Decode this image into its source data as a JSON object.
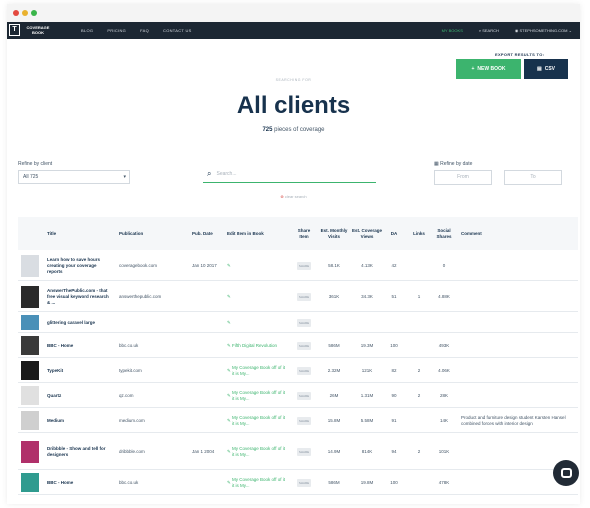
{
  "brand": {
    "logo_text": "COVERAGE BOOK",
    "logo_glyph": "T"
  },
  "nav": {
    "links": [
      "BLOG",
      "PRICING",
      "FAQ",
      "CONTACT US"
    ],
    "my_books": "MY BOOKS",
    "search": "SEARCH",
    "account": "STEPHSOMETHING.COM"
  },
  "export": {
    "label": "EXPORT RESULTS TO:",
    "new_book": "NEW BOOK",
    "csv": "CSV"
  },
  "header": {
    "eyebrow": "SEARCHING FOR",
    "title": "All clients",
    "count": "725",
    "count_suffix": "pieces of coverage"
  },
  "filters": {
    "refine_label": "Refine by client",
    "refine_value": "All 725",
    "search_placeholder": "Search...",
    "clear_search": "clear search",
    "date_label": "Refine by date",
    "date_from": "From",
    "date_to": "To"
  },
  "table": {
    "headers": [
      "Title",
      "Publication",
      "Pub. Date",
      "Edit Item in Book",
      "Share Item",
      "Est. Monthly Visits",
      "Est. Coverage Views",
      "DA",
      "Links",
      "Social Shares",
      "Comment"
    ],
    "share_label": "SHARE",
    "rows": [
      {
        "title": "Learn how to save hours creating your coverage reports",
        "publication": "coveragebook.com",
        "date": "Jan 10 2017",
        "book": "",
        "visits": "58.1K",
        "views": "4.13K",
        "da": "42",
        "links": "",
        "shares": "0",
        "comment": "",
        "thumb": "#d9dde2"
      },
      {
        "title": "AnswerThePublic.com - that free visual keyword research & ...",
        "publication": "answerthepublic.com",
        "date": "",
        "book": "",
        "visits": "361K",
        "views": "34.3K",
        "da": "51",
        "links": "1",
        "shares": "4.88K",
        "comment": "",
        "thumb": "#2b2b2b"
      },
      {
        "title": "glittering caravel large",
        "publication": "",
        "date": "",
        "book": "",
        "visits": "",
        "views": "",
        "da": "",
        "links": "",
        "shares": "",
        "comment": "",
        "thumb": "#4a90b8"
      },
      {
        "title": "BBC - Home",
        "publication": "bbc.co.uk",
        "date": "",
        "book": "Fifth Digital Revolution",
        "visits": "586M",
        "views": "19.3M",
        "da": "100",
        "links": "",
        "shares": "493K",
        "comment": "",
        "thumb": "#3a3a3a"
      },
      {
        "title": "TypeKit",
        "publication": "typekit.com",
        "date": "",
        "book": "My Coverage Book off of it it is My...",
        "visits": "2.32M",
        "views": "121K",
        "da": "82",
        "links": "2",
        "shares": "4.06K",
        "comment": "",
        "thumb": "#1a1a1a"
      },
      {
        "title": "Quartz",
        "publication": "qz.com",
        "date": "",
        "book": "My Coverage Book off of it it is My...",
        "visits": "26M",
        "views": "1.31M",
        "da": "90",
        "links": "2",
        "shares": "28K",
        "comment": "",
        "thumb": "#e0e0e0"
      },
      {
        "title": "Medium",
        "publication": "medium.com",
        "date": "",
        "book": "My Coverage Book off of it it is My...",
        "visits": "15.8M",
        "views": "5.58M",
        "da": "91",
        "links": "",
        "shares": "14K",
        "comment": "Product and furniture design student Karsten Hansel combined forces with interior design",
        "thumb": "#cfcfcf"
      },
      {
        "title": "Dribbble - Show and tell for designers",
        "publication": "dribbble.com",
        "date": "Jan 1 2004",
        "book": "My Coverage Book off of it it is My...",
        "visits": "14.9M",
        "views": "814K",
        "da": "94",
        "links": "2",
        "shares": "101K",
        "comment": "",
        "thumb": "#b0306a"
      },
      {
        "title": "BBC - Home",
        "publication": "bbc.co.uk",
        "date": "",
        "book": "My Coverage Book off of it it is My...",
        "visits": "586M",
        "views": "19.8M",
        "da": "100",
        "links": "",
        "shares": "478K",
        "comment": "",
        "thumb": "#2f9b8f"
      }
    ]
  },
  "colors": {
    "nav_bg": "#1c2733",
    "accent_green": "#3cb46e",
    "navy": "#17324d"
  },
  "icons": [
    "search-icon",
    "calendar-icon",
    "chevron-down-icon",
    "chat-icon",
    "document-icon",
    "plus-icon"
  ]
}
